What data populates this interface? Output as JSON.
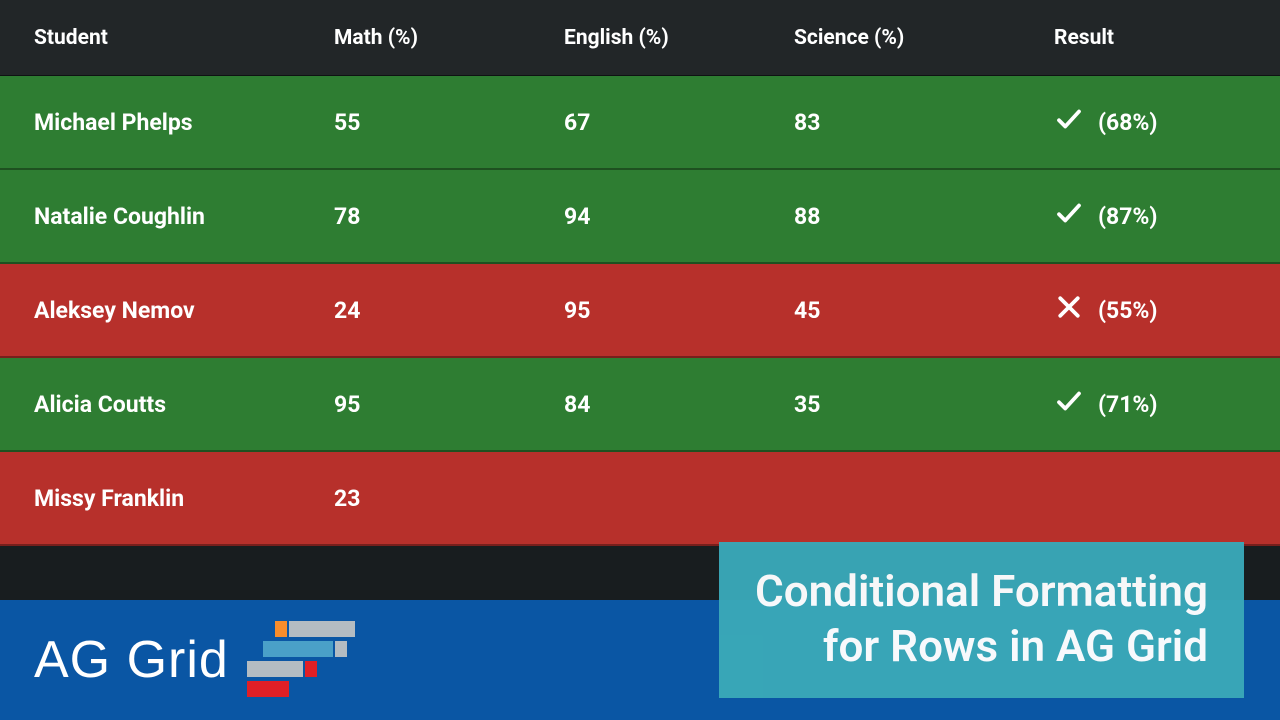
{
  "columns": {
    "student": "Student",
    "math": "Math (%)",
    "english": "English (%)",
    "science": "Science (%)",
    "result": "Result"
  },
  "rows": [
    {
      "student": "Michael Phelps",
      "math": "55",
      "english": "67",
      "science": "83",
      "avg": "(68%)",
      "pass": true
    },
    {
      "student": "Natalie Coughlin",
      "math": "78",
      "english": "94",
      "science": "88",
      "avg": "(87%)",
      "pass": true
    },
    {
      "student": "Aleksey Nemov",
      "math": "24",
      "english": "95",
      "science": "45",
      "avg": "(55%)",
      "pass": false
    },
    {
      "student": "Alicia Coutts",
      "math": "95",
      "english": "84",
      "science": "35",
      "avg": "(71%)",
      "pass": true
    },
    {
      "student": "Missy Franklin",
      "math": "23",
      "english": "",
      "science": "",
      "avg": "",
      "pass": false
    }
  ],
  "brand": {
    "name": "AG Grid"
  },
  "title": {
    "line1": "Conditional Formatting",
    "line2": "for Rows in AG Grid"
  }
}
